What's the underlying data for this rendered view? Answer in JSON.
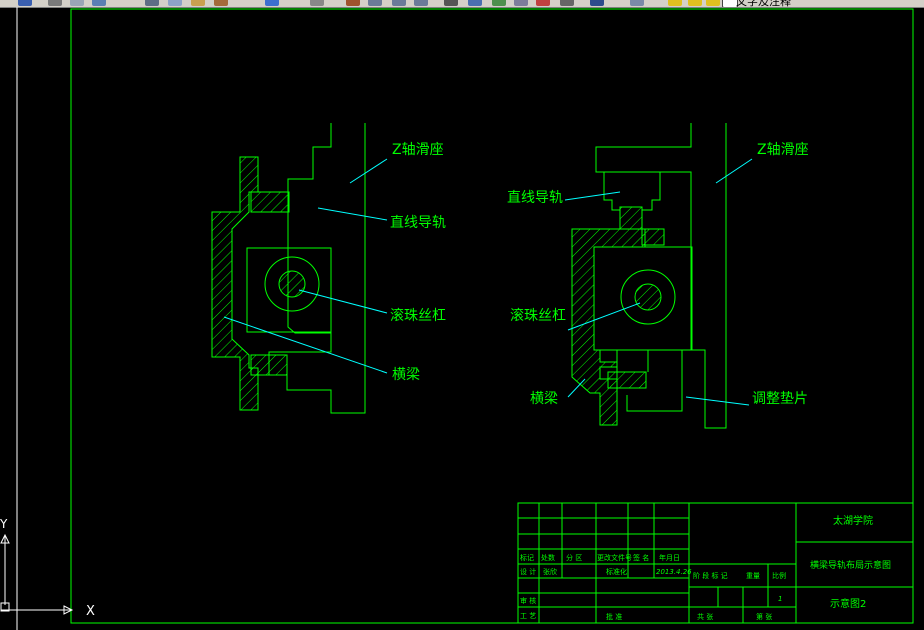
{
  "toolbar": {
    "layer_name": "文字及注释"
  },
  "drawing": {
    "left_view": {
      "z_slide_label": "Z轴滑座",
      "rail_label": "直线导轨",
      "ballscrew_label": "滚珠丝杠",
      "beam_label": "横梁"
    },
    "right_view": {
      "z_slide_label": "Z轴滑座",
      "rail_label": "直线导轨",
      "ballscrew_label": "滚珠丝杠",
      "beam_label": "横梁",
      "shim_label": "调整垫片"
    }
  },
  "title_block": {
    "school": "太湖学院",
    "drawing_title": "横梁导轨布局示意图",
    "drawing_no": "示意图2",
    "rev_headers": [
      "标记",
      "处数",
      "分 区",
      "更改文件号",
      "签 名",
      "年月日"
    ],
    "designer_label": "设 计",
    "designer_name": "张欣",
    "standardize_label": "标准化",
    "date": "2013.4.26",
    "stage_label": "阶 段 标 记",
    "weight_label": "重量",
    "scale_label": "比例",
    "scale_value": "1",
    "review_label": "审 核",
    "process_label": "工 艺",
    "approve_label": "批 准",
    "sheets_label": "共 张",
    "sheet_label": "第 张"
  },
  "ucs": {
    "x_label": "X",
    "y_label": "Y"
  },
  "colors": {
    "background": "#000000",
    "geometry": "#00ff00",
    "leader": "#00ffff",
    "text": "#00ff00",
    "ucs": "#ffffff"
  }
}
